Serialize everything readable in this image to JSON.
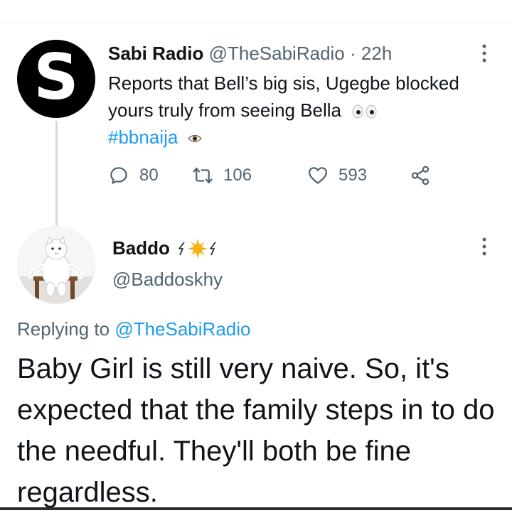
{
  "parent_tweet": {
    "avatar_letter": "S",
    "display_name": "Sabi Radio",
    "handle": "@TheSabiRadio",
    "separator": "·",
    "time": "22h",
    "text": "Reports that Bell’s big sis, Ugegbe blocked yours truly from seeing Bella",
    "hashtag": "#bbnaija",
    "actions": {
      "replies": "80",
      "retweets": "106",
      "likes": "593"
    }
  },
  "reply_tweet": {
    "display_name": "Baddo",
    "handle": "@Baddoskhy",
    "replying_prefix": "Replying to",
    "replying_mention": "@TheSabiRadio",
    "text": "Baby Girl is still very naive. So, it's expected that the family steps in to do the needful. They'll both be fine regardless."
  },
  "icons": [
    "eyes-emoji-icon",
    "eye-emoji-icon",
    "reply-icon",
    "retweet-icon",
    "like-icon",
    "share-icon",
    "more-icon",
    "sun-emoji-icon",
    "lightning-emoji-icon"
  ],
  "colors": {
    "text": "#0f1419",
    "secondary": "#536471",
    "link": "#1d9bf0",
    "thread_line": "#cfd9de"
  }
}
